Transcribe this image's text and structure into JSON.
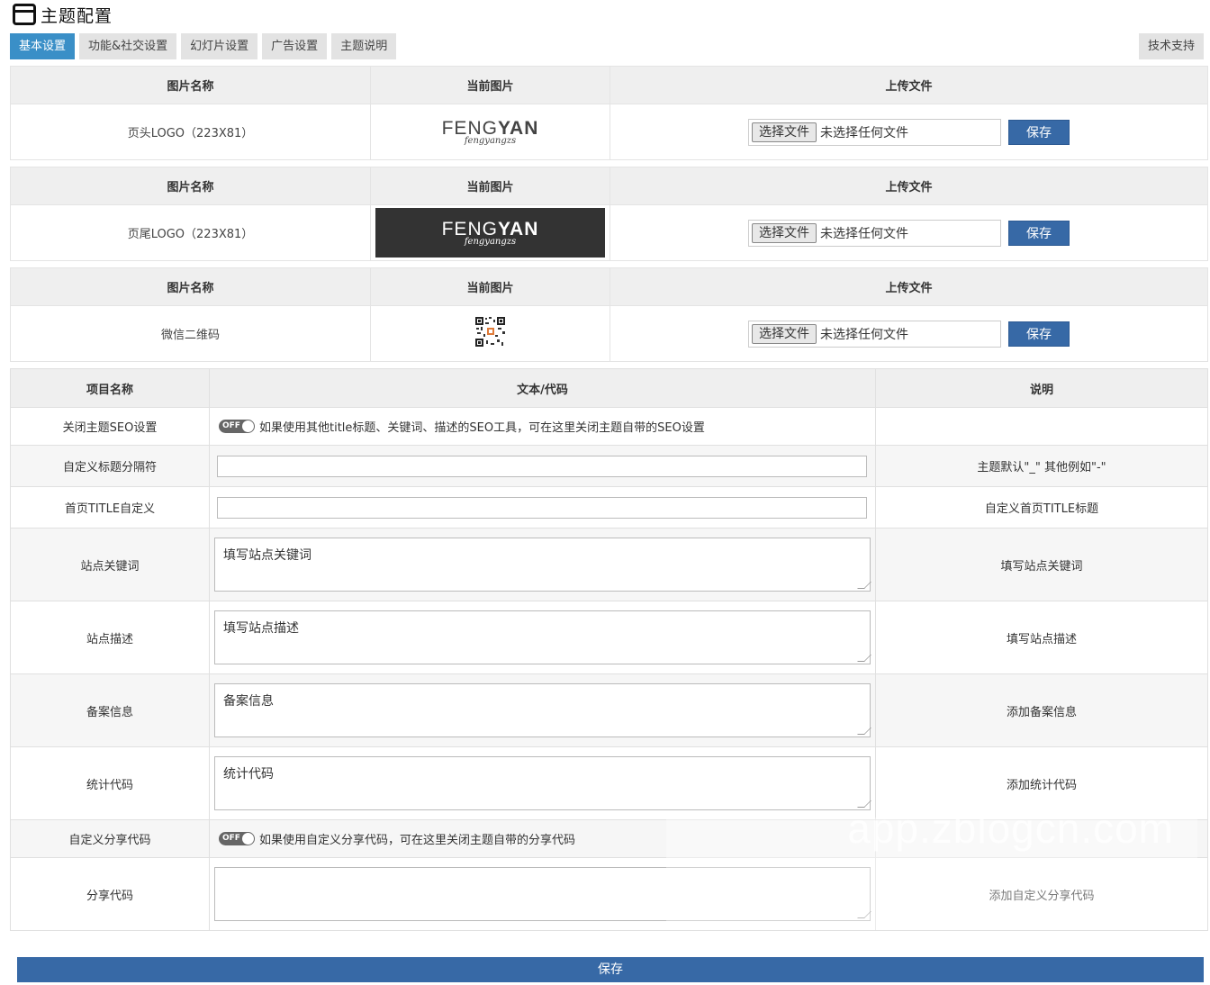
{
  "header": {
    "title": "主题配置",
    "icon": "window-icon"
  },
  "tabs": [
    {
      "label": "基本设置",
      "active": true
    },
    {
      "label": "功能&社交设置",
      "active": false
    },
    {
      "label": "幻灯片设置",
      "active": false
    },
    {
      "label": "广告设置",
      "active": false
    },
    {
      "label": "主题说明",
      "active": false
    }
  ],
  "support_tab": "技术支持",
  "image_tables": {
    "headers": [
      "图片名称",
      "当前图片",
      "上传文件"
    ],
    "rows": [
      {
        "name": "页头LOGO（223X81）",
        "logo_main_a": "FENG",
        "logo_main_b": "YAN",
        "logo_sub": "fengyangzs",
        "file_button": "选择文件",
        "file_status": "未选择任何文件",
        "save": "保存"
      },
      {
        "name": "页尾LOGO（223X81）",
        "logo_main_a": "FENG",
        "logo_main_b": "YAN",
        "logo_sub": "fengyangzs",
        "file_button": "选择文件",
        "file_status": "未选择任何文件",
        "save": "保存"
      },
      {
        "name": "微信二维码",
        "image": "qr-code-image",
        "file_button": "选择文件",
        "file_status": "未选择任何文件",
        "save": "保存"
      }
    ]
  },
  "settings": {
    "headers": [
      "项目名称",
      "文本/代码",
      "说明"
    ],
    "rows": {
      "seo": {
        "name": "关闭主题SEO设置",
        "toggle": "OFF",
        "text": "如果使用其他title标题、关键词、描述的SEO工具，可在这里关闭主题自带的SEO设置",
        "desc": ""
      },
      "separator": {
        "name": "自定义标题分隔符",
        "value": "",
        "desc": "主题默认\"_\" 其他例如\"-\""
      },
      "home_title": {
        "name": "首页TITLE自定义",
        "value": "",
        "desc": "自定义首页TITLE标题"
      },
      "keywords": {
        "name": "站点关键词",
        "value": "填写站点关键词",
        "desc": "填写站点关键词"
      },
      "description": {
        "name": "站点描述",
        "value": "填写站点描述",
        "desc": "填写站点描述"
      },
      "beian": {
        "name": "备案信息",
        "value": "备案信息",
        "desc": "添加备案信息"
      },
      "stats": {
        "name": "统计代码",
        "value": "统计代码",
        "desc": "添加统计代码"
      },
      "share_toggle": {
        "name": "自定义分享代码",
        "toggle": "OFF",
        "text": "如果使用自定义分享代码，可在这里关闭主题自带的分享代码",
        "desc": ""
      },
      "share_code": {
        "name": "分享代码",
        "value": "",
        "desc": "添加自定义分享代码"
      }
    }
  },
  "bottom_save": "保存",
  "watermark": "app.zblogcn.com",
  "colors": {
    "accent": "#3a8fc7",
    "button": "#3769a6",
    "header_bg": "#efefef"
  }
}
